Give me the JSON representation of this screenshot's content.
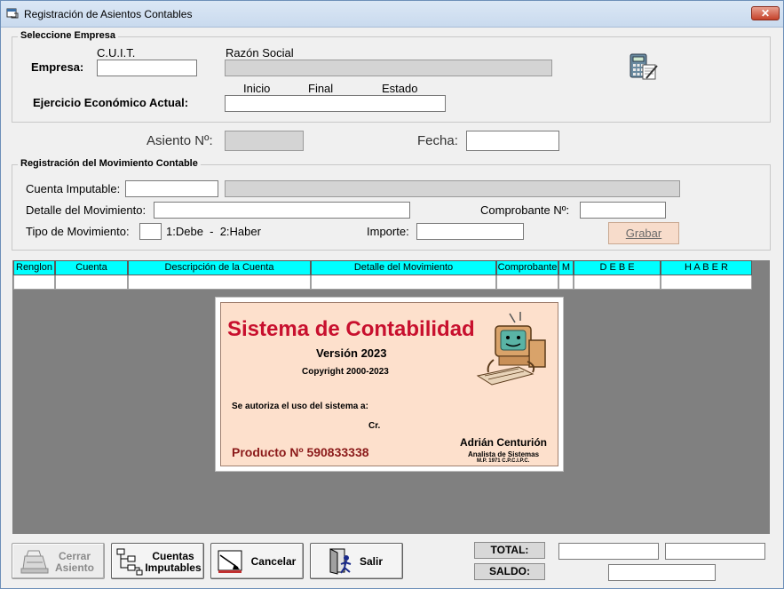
{
  "window": {
    "title": "Registración de Asientos Contables",
    "close_label": "✕"
  },
  "empresa_group": {
    "legend": "Seleccione Empresa",
    "cuit_header": "C.U.I.T.",
    "razon_header": "Razón Social",
    "empresa_label": "Empresa:",
    "cuit_value": "",
    "razon_value": "",
    "ejercicio_label": "Ejercicio Económico Actual:",
    "inicio_header": "Inicio",
    "final_header": "Final",
    "estado_header": "Estado",
    "ejercicio_value": "",
    "calc_icon": "calculator-icon"
  },
  "asiento": {
    "asiento_label": "Asiento Nº:",
    "asiento_value": "",
    "fecha_label": "Fecha:",
    "fecha_value": ""
  },
  "movimiento_group": {
    "legend": "Registración del Movimiento Contable",
    "cuenta_label": "Cuenta Imputable:",
    "cuenta_value": "",
    "cuenta_desc_value": "",
    "detalle_label": "Detalle del Movimiento:",
    "detalle_value": "",
    "comprobante_label": "Comprobante Nº:",
    "comprobante_value": "",
    "tipo_label": "Tipo de Movimiento:",
    "tipo_value": "",
    "tipo_hint": "1:Debe  -  2:Haber",
    "importe_label": "Importe:",
    "importe_value": "",
    "grabar_label": "Grabar"
  },
  "grid": {
    "columns": [
      "Renglon",
      "Cuenta",
      "Descripción de la Cuenta",
      "Detalle del Movimiento",
      "Comprobante",
      "M",
      "D E B E",
      "H A B E R"
    ]
  },
  "splash": {
    "title": "Sistema de Contabilidad",
    "version": "Versión 2023",
    "copyright": "Copyright 2000-2023",
    "autoriza": "Se autoriza el uso del sistema a:",
    "usuario": "Cr.",
    "producto": "Producto Nº 590833338",
    "autor": "Adrián Centurión",
    "autor_titulo": "Analista de Sistemas",
    "autor_matricula": "M.P. 1971 C.P.C.I.P.C.",
    "mascot_icon": "computer-mascot-icon"
  },
  "buttons": {
    "cerrar_line1": "Cerrar",
    "cerrar_line2": "Asiento",
    "cuentas_line1": "Cuentas",
    "cuentas_line2": "Imputables",
    "cancelar": "Cancelar",
    "salir": "Salir"
  },
  "totals": {
    "total_label": "TOTAL:",
    "saldo_label": "SALDO:",
    "total_debe": "",
    "total_haber": "",
    "saldo_value": ""
  },
  "colors": {
    "grid_header": "#00ffff",
    "splash_bg": "#fde0cc",
    "splash_title": "#c8102e",
    "producto": "#8b1a1a"
  }
}
